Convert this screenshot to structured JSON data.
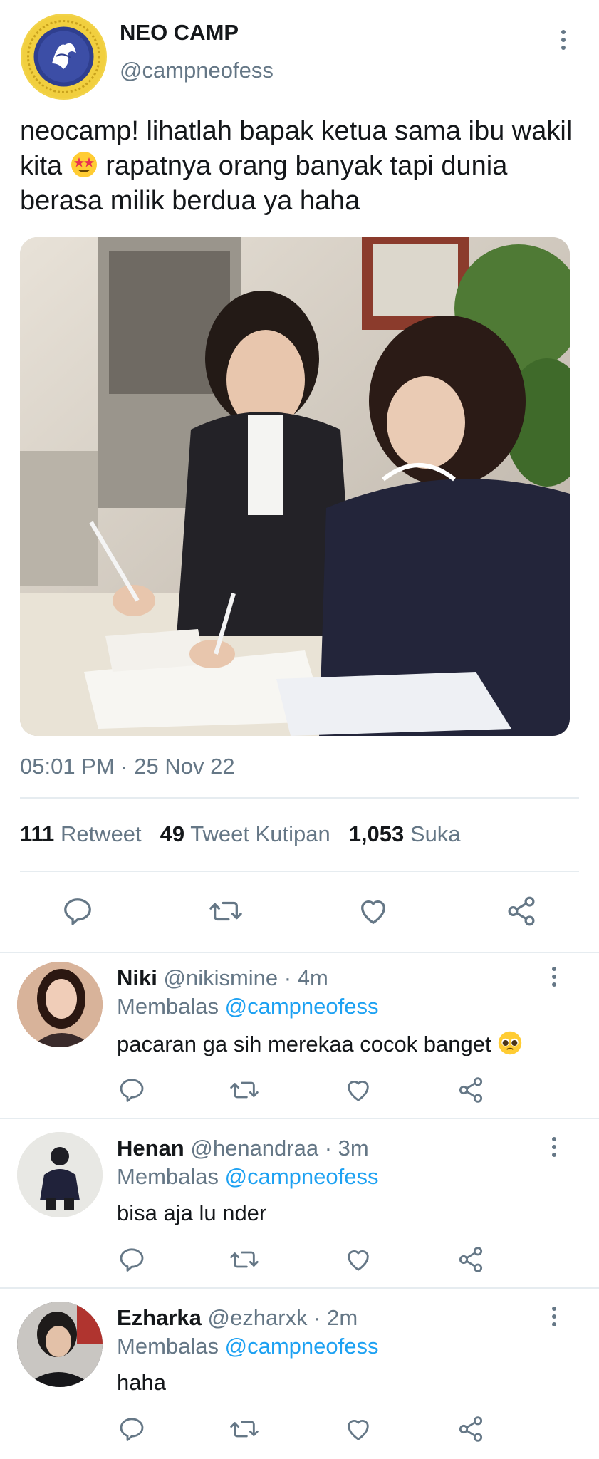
{
  "tweet": {
    "author_name": "NEO CAMP",
    "author_handle": "@campneofess",
    "text_part1": "neocamp! lihatlah bapak ketua sama ibu wakil kita ",
    "text_part2": " rapatnya orang banyak tapi dunia berasa milik berdua ya haha",
    "timestamp": "05:01 PM · 25 Nov 22",
    "stats": {
      "retweets_count": "111",
      "retweets_label": "Retweet",
      "quotes_count": "49",
      "quotes_label": "Tweet Kutipan",
      "likes_count": "1,053",
      "likes_label": "Suka"
    },
    "actions": [
      "reply-icon",
      "retweet-icon",
      "like-icon",
      "share-icon"
    ]
  },
  "replies": [
    {
      "name": "Niki",
      "handle": "@nikismine",
      "time": "· 4m",
      "replying_label": "Membalas",
      "replying_to": "@campneofess",
      "text": "pacaran ga sih merekaa cocok banget"
    },
    {
      "name": "Henan",
      "handle": "@henandraa",
      "time": "· 3m",
      "replying_label": "Membalas",
      "replying_to": "@campneofess",
      "text": "bisa aja lu nder"
    },
    {
      "name": "Ezharka",
      "handle": "@ezharxk",
      "time": "· 2m",
      "replying_label": "Membalas",
      "replying_to": "@campneofess",
      "text": "haha"
    }
  ],
  "colors": {
    "accent": "#1da1f2",
    "secondary_text": "#657786",
    "divider": "#e6ecf0"
  }
}
